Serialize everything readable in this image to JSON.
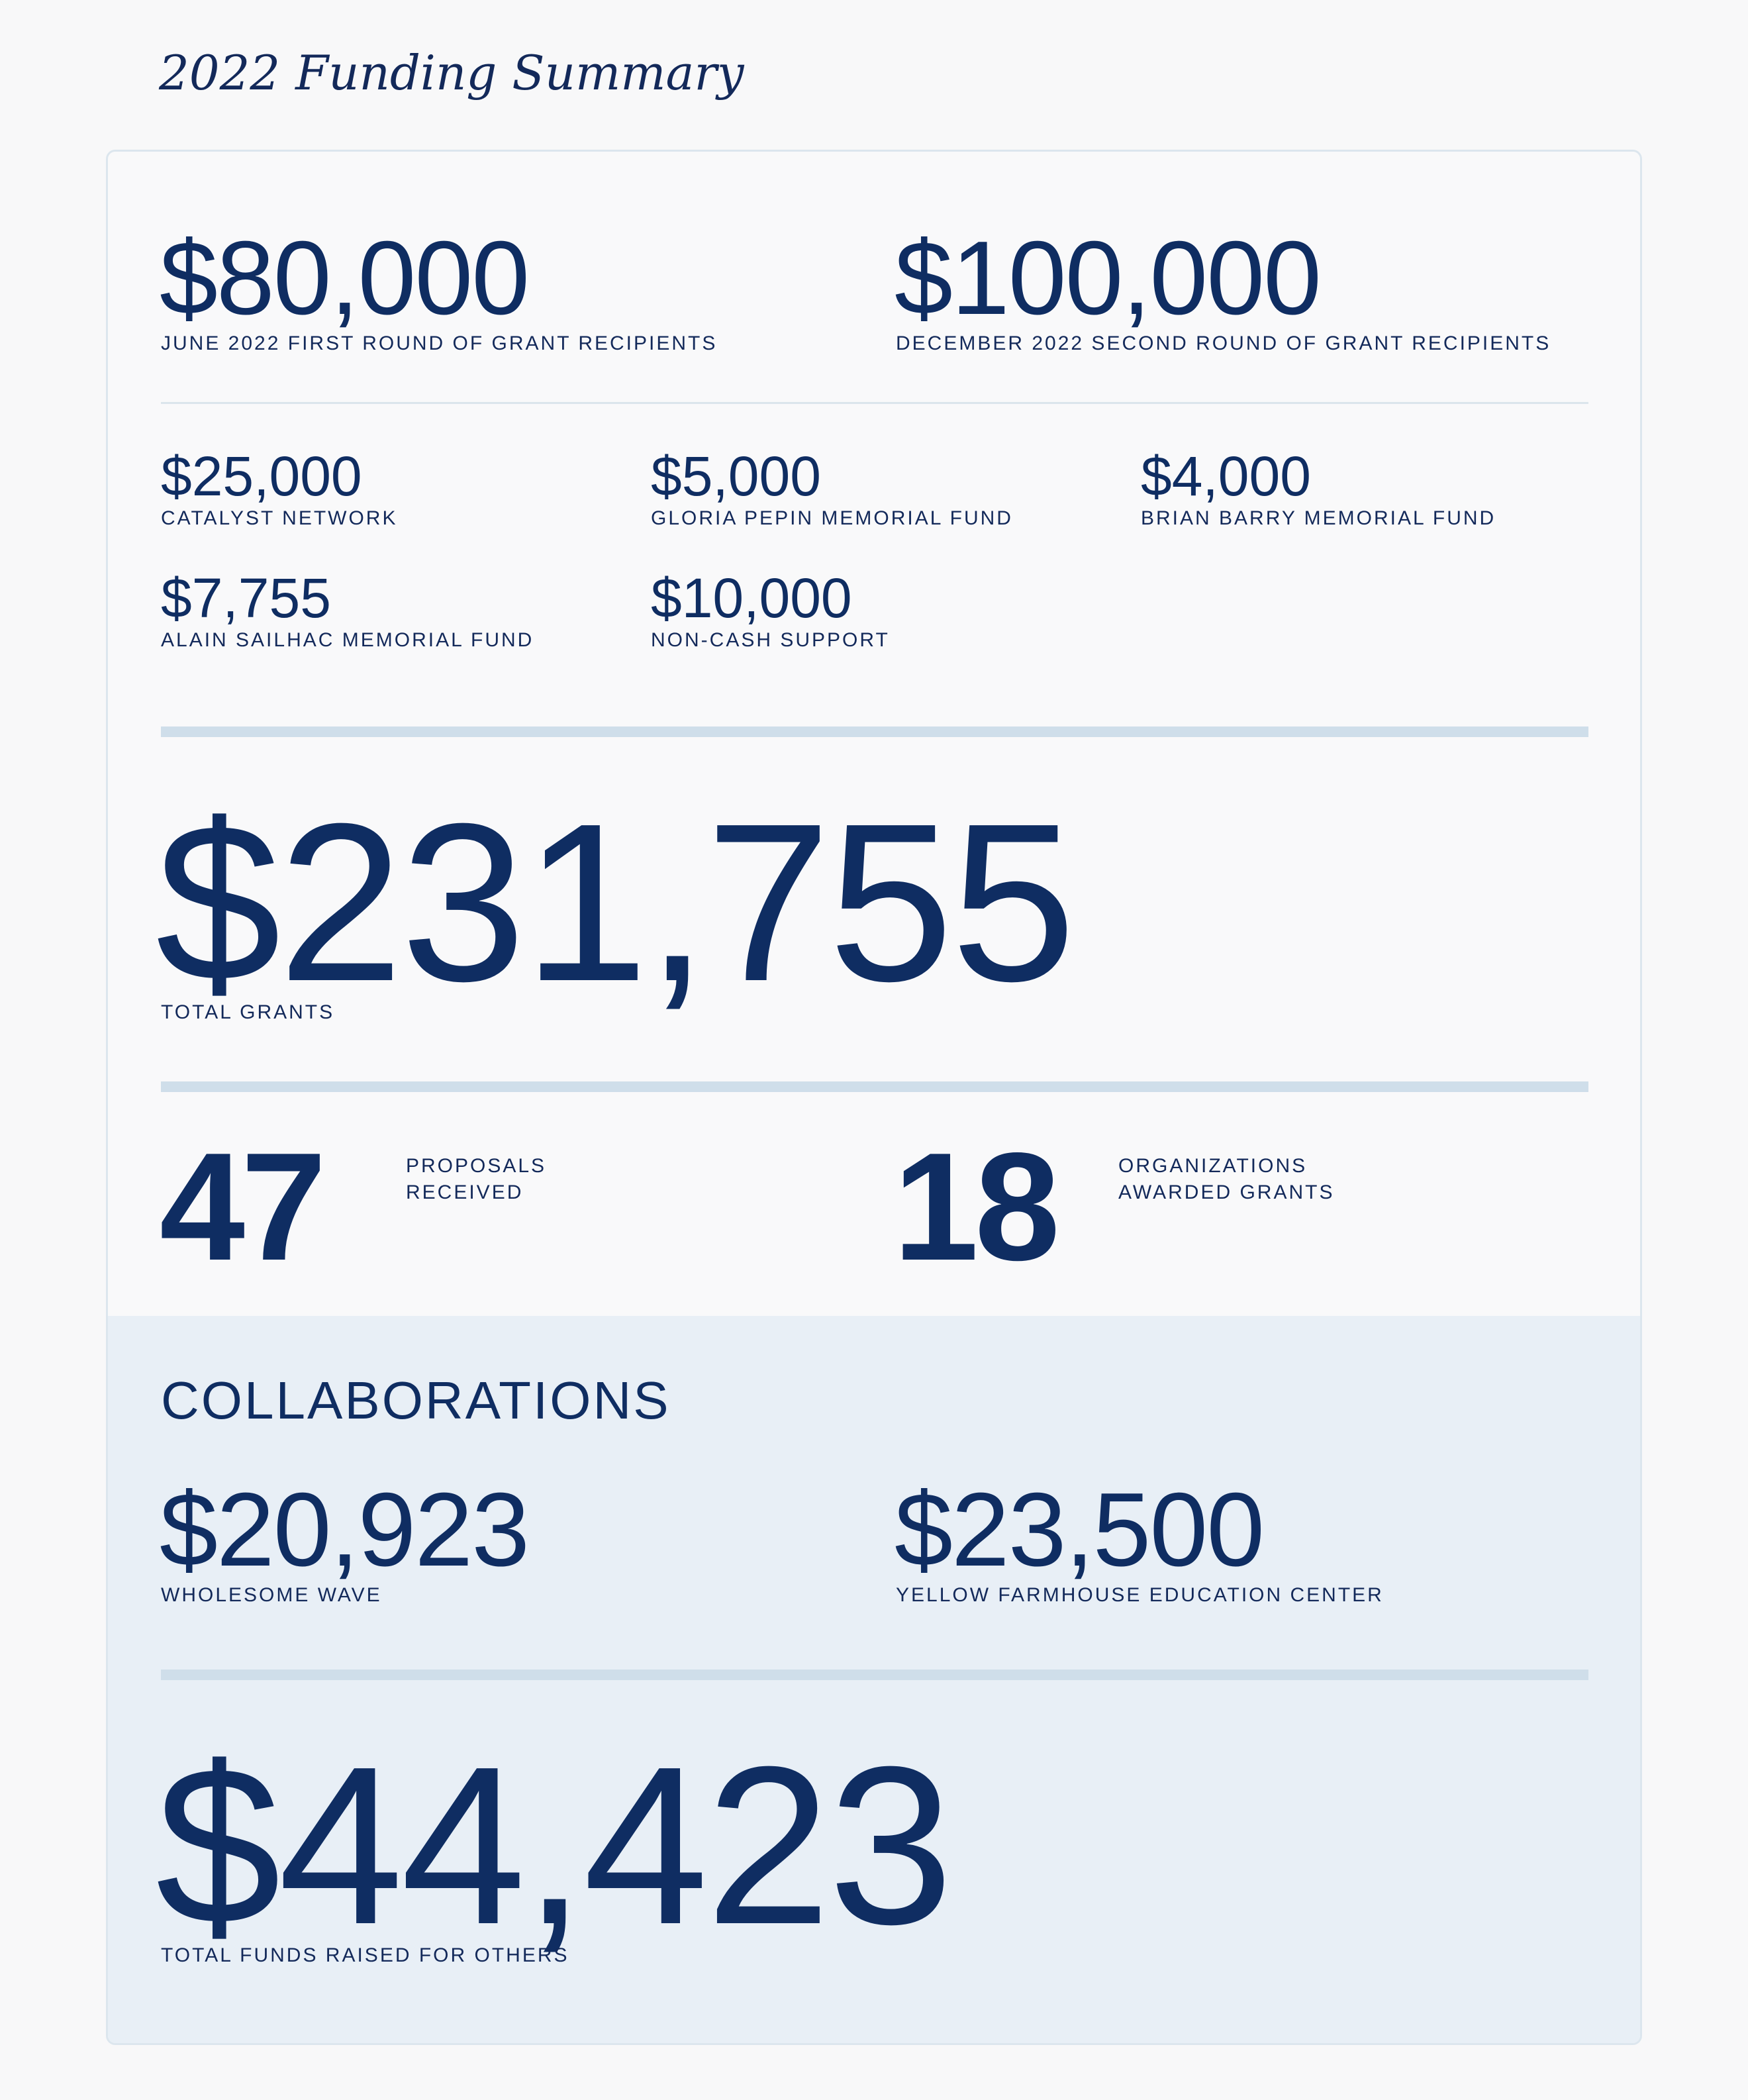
{
  "page_title": "2022 Funding Summary",
  "rounds": [
    {
      "amount": "$80,000",
      "label": "JUNE 2022 FIRST ROUND OF GRANT RECIPIENTS"
    },
    {
      "amount": "$100,000",
      "label": "DECEMBER 2022 SECOND ROUND OF GRANT RECIPIENTS"
    }
  ],
  "funds": [
    {
      "amount": "$25,000",
      "label": "CATALYST NETWORK"
    },
    {
      "amount": "$5,000",
      "label": "GLORIA PEPIN MEMORIAL FUND"
    },
    {
      "amount": "$4,000",
      "label": "BRIAN BARRY MEMORIAL FUND"
    },
    {
      "amount": "$7,755",
      "label": "ALAIN SAILHAC MEMORIAL FUND"
    },
    {
      "amount": "$10,000",
      "label": "NON-CASH SUPPORT"
    }
  ],
  "total_grants": {
    "amount": "$231,755",
    "label": "TOTAL GRANTS"
  },
  "stats": [
    {
      "number": "47",
      "label_line1": "PROPOSALS",
      "label_line2": "RECEIVED"
    },
    {
      "number": "18",
      "label_line1": "ORGANIZATIONS",
      "label_line2": "AWARDED GRANTS"
    }
  ],
  "collaborations": {
    "heading": "COLLABORATIONS",
    "items": [
      {
        "amount": "$20,923",
        "label": "WHOLESOME WAVE"
      },
      {
        "amount": "$23,500",
        "label": "YELLOW FARMHOUSE EDUCATION CENTER"
      }
    ],
    "total": {
      "amount": "$44,423",
      "label": "TOTAL FUNDS RAISED FOR OTHERS"
    }
  },
  "colors": {
    "navy": "#0f2d62",
    "page_background": "#f8f8f9",
    "collaborations_background": "#e8eff6",
    "divider": "#cfdeea"
  }
}
